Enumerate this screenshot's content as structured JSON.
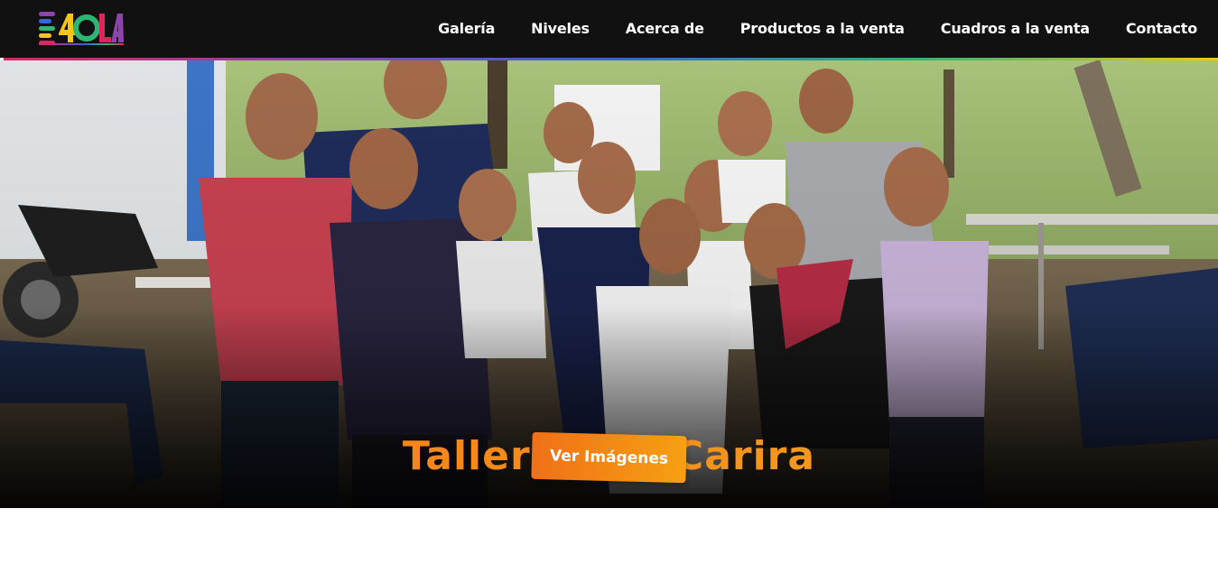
{
  "header": {
    "logo_text": "EOLA",
    "nav": [
      {
        "label": "Galería"
      },
      {
        "label": "Niveles"
      },
      {
        "label": "Acerca de"
      },
      {
        "label": "Productos a la venta"
      },
      {
        "label": "Cuadros a la venta"
      },
      {
        "label": "Contacto"
      }
    ]
  },
  "hero": {
    "title": "Taller en El Carira",
    "cta_label": "Ver Imágenes"
  },
  "colors": {
    "header_bg": "#111111",
    "accent_orange": "#f58a1f",
    "logo_colors": [
      "#e0245e",
      "#8e44ad",
      "#3466d6",
      "#2bb673",
      "#f5c518"
    ]
  }
}
